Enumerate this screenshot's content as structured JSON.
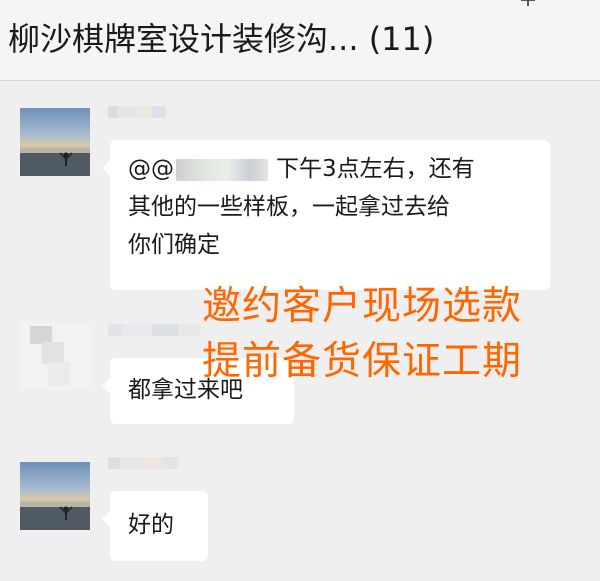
{
  "header": {
    "title": "柳沙棋牌室设计装修沟... (11)"
  },
  "messages": [
    {
      "mention": "@@",
      "mention_tail": "下午3点左右，还有",
      "line2": "其他的一些样板，一起拿过去给",
      "line3": "你们确定"
    },
    {
      "text": "都拿过来吧"
    },
    {
      "text": "好的"
    }
  ],
  "overlay": {
    "line1": "邀约客户现场选款",
    "line2": "提前备货保证工期"
  },
  "colors": {
    "overlay_text": "#ff6600",
    "chat_background": "#efefef",
    "bubble": "#ffffff"
  }
}
